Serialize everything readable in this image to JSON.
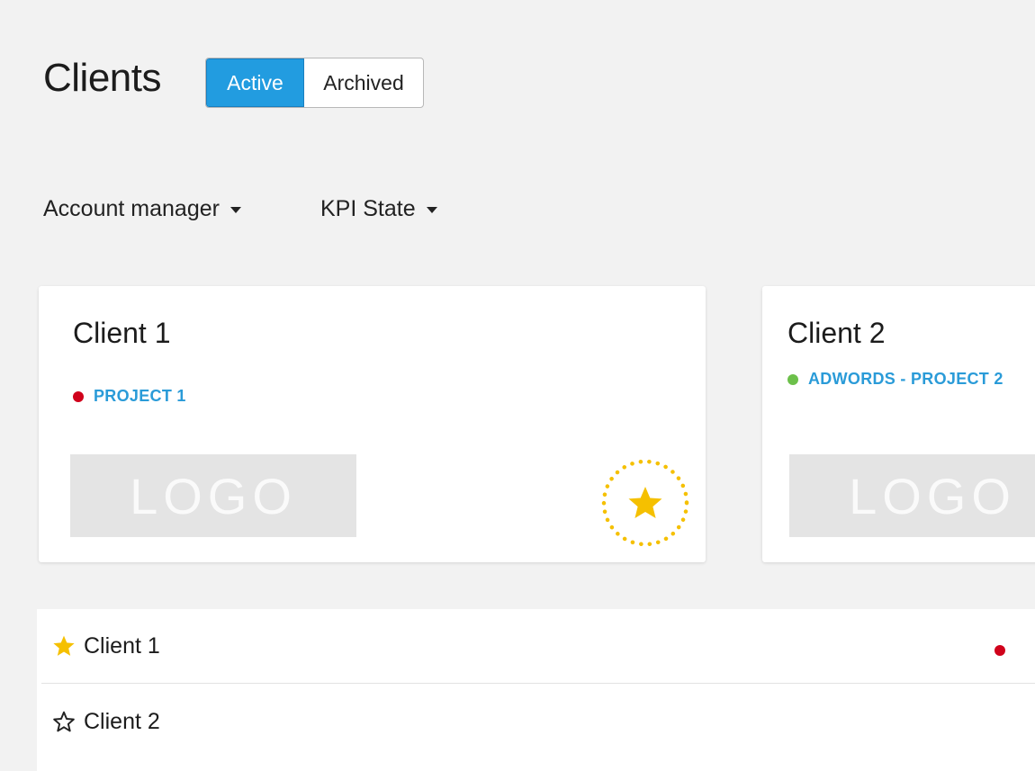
{
  "header": {
    "title": "Clients",
    "toggle": {
      "active_label": "Active",
      "archived_label": "Archived",
      "selected": "Active"
    }
  },
  "filters": {
    "account_manager": "Account manager",
    "kpi_state": "KPI State"
  },
  "cards": [
    {
      "title": "Client 1",
      "project": "PROJECT 1",
      "status_color": "#d0021b",
      "logo_text": "LOGO",
      "favorite": true
    },
    {
      "title": "Client 2",
      "project": "ADWORDS - PROJECT 2",
      "status_color": "#6cc04a",
      "logo_text": "LOGO",
      "favorite": false
    }
  ],
  "list": [
    {
      "name": "Client 1",
      "starred": true,
      "status_color": "#d0021b"
    },
    {
      "name": "Client 2",
      "starred": false
    }
  ],
  "icons": {
    "caret": "caret-down-icon",
    "star_filled": "star-filled-icon",
    "star_outline": "star-outline-icon",
    "status_dot": "status-dot-icon"
  },
  "colors": {
    "accent": "#229ce0",
    "link": "#2a9bd8",
    "star": "#f5c000",
    "background": "#f2f2f2"
  }
}
